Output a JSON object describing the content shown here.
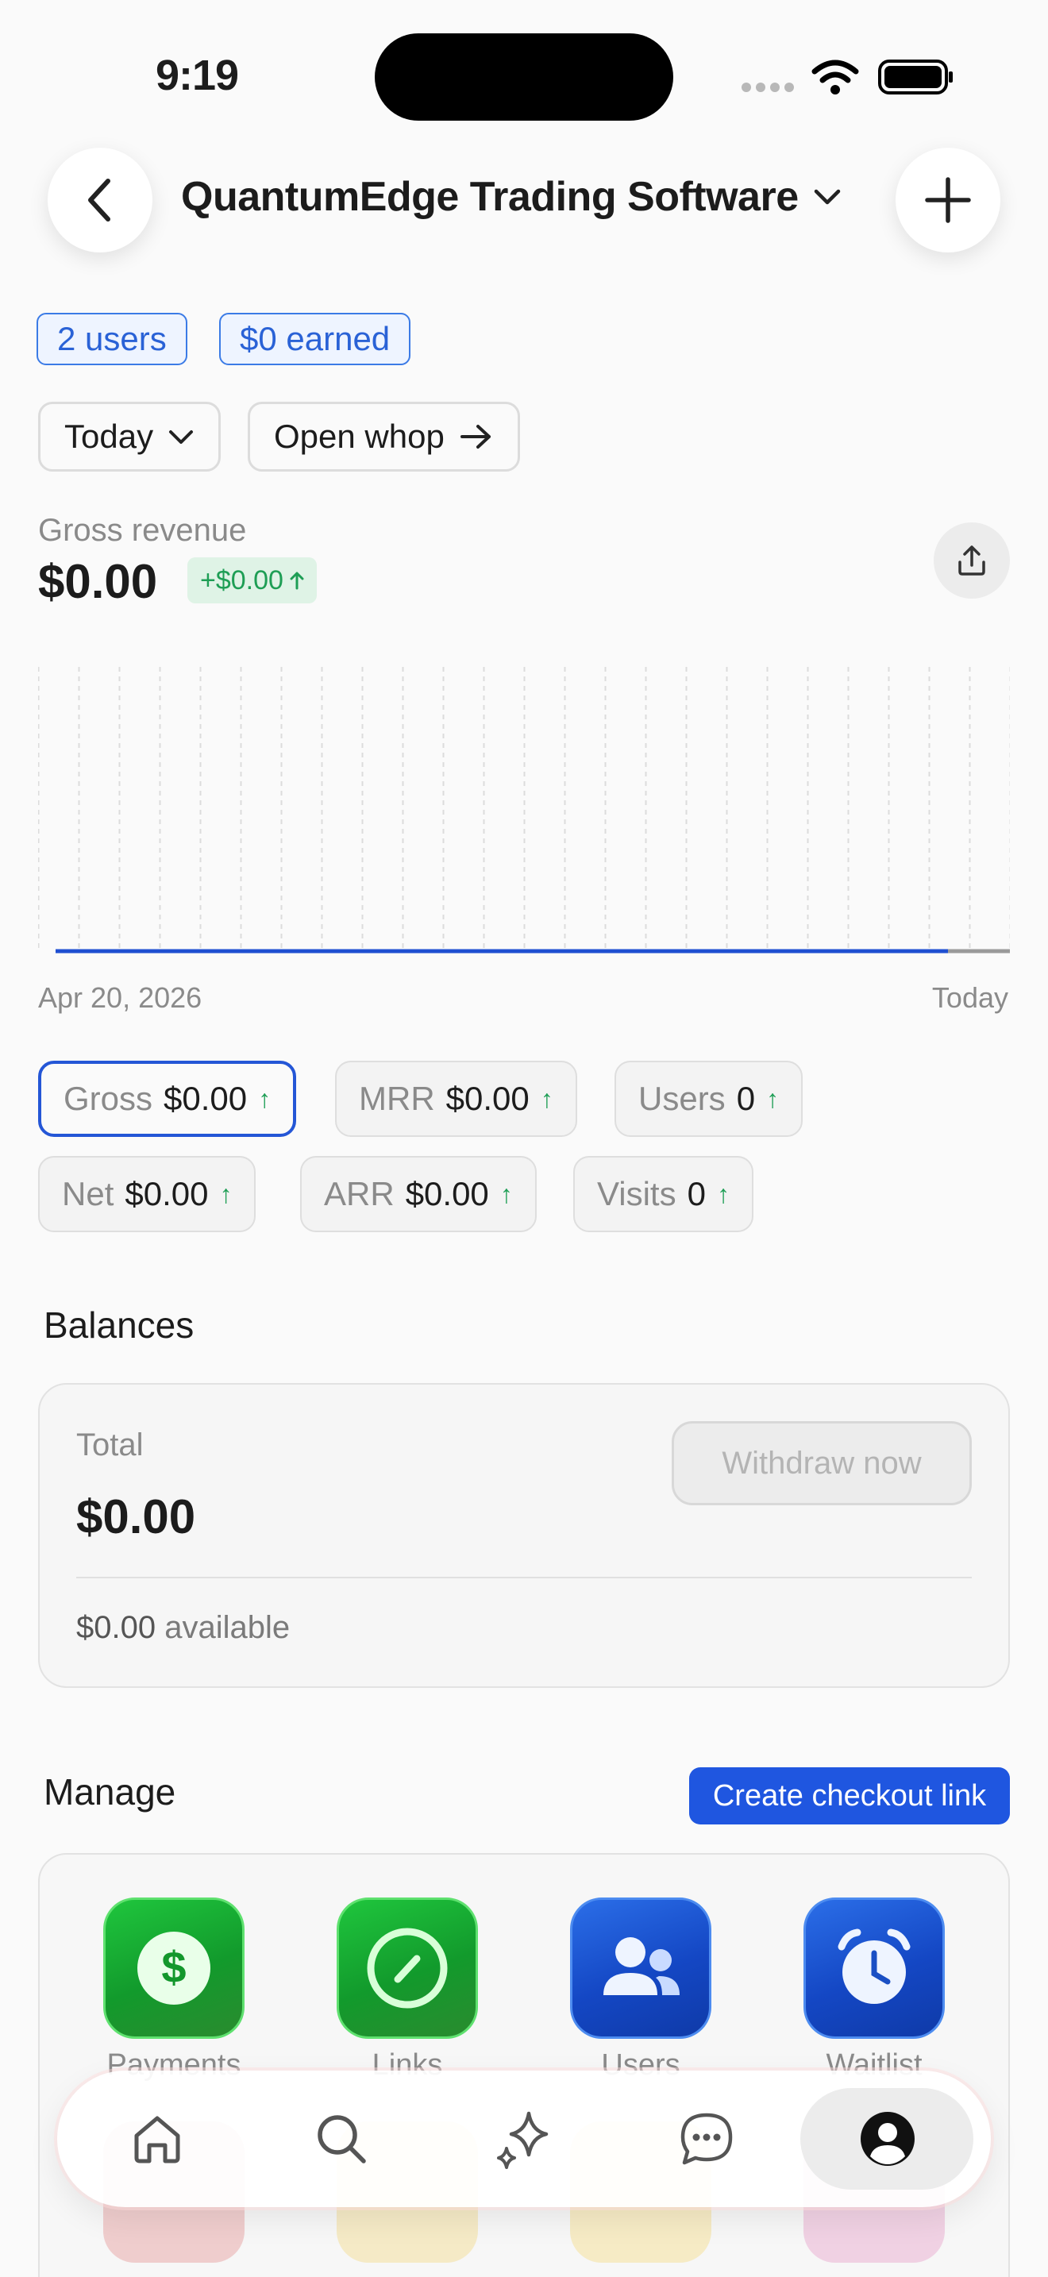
{
  "status_bar": {
    "time": "9:19"
  },
  "header": {
    "title": "QuantumEdge Trading Software"
  },
  "badges": {
    "users": "2 users",
    "earned": "$0 earned"
  },
  "controls": {
    "range": "Today",
    "open_whop": "Open whop"
  },
  "revenue": {
    "label": "Gross revenue",
    "value": "$0.00",
    "delta": "+$0.00"
  },
  "chart_data": {
    "type": "line",
    "x_labels": [
      "Apr 20, 2026",
      "Today"
    ],
    "series": [
      {
        "values": [
          0,
          0
        ]
      }
    ]
  },
  "metrics": [
    {
      "key": "Gross",
      "value": "$0.00"
    },
    {
      "key": "MRR",
      "value": "$0.00"
    },
    {
      "key": "Users",
      "value": "0"
    },
    {
      "key": "Net",
      "value": "$0.00"
    },
    {
      "key": "ARR",
      "value": "$0.00"
    },
    {
      "key": "Visits",
      "value": "0"
    }
  ],
  "balances": {
    "title": "Balances",
    "total_label": "Total",
    "total_value": "$0.00",
    "withdraw": "Withdraw now",
    "available_amount": "$0.00",
    "available_text": "available"
  },
  "manage": {
    "title": "Manage",
    "checkout_button": "Create checkout link",
    "apps": [
      {
        "label": "Payments",
        "icon": "dollar-icon"
      },
      {
        "label": "Links",
        "icon": "link-icon"
      },
      {
        "label": "Users",
        "icon": "users-icon"
      },
      {
        "label": "Waitlist",
        "icon": "alarm-icon"
      }
    ]
  },
  "colors": {
    "accent": "#1f56e0",
    "positive": "#1e9e55"
  },
  "tabbar": {
    "icons": [
      "home-icon",
      "search-icon",
      "sparkle-icon",
      "chat-icon",
      "profile-icon"
    ],
    "active": "profile-icon"
  }
}
